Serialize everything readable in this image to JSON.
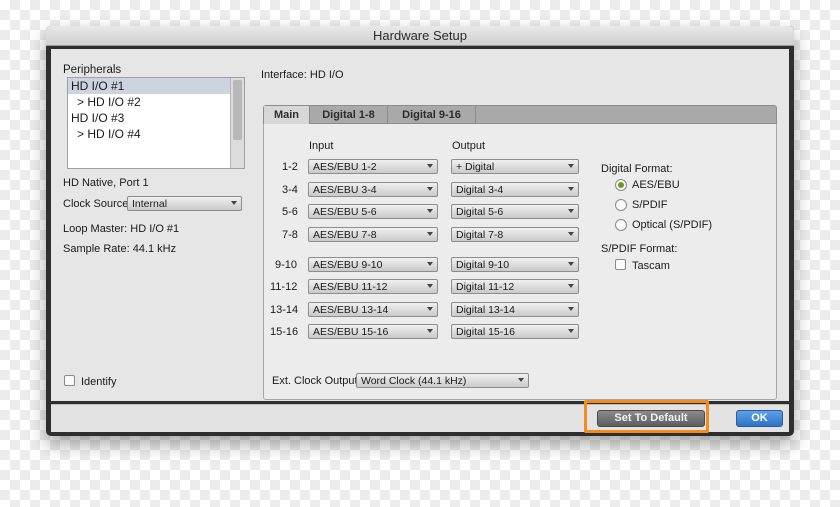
{
  "window": {
    "title": "Hardware Setup"
  },
  "peripherals": {
    "heading": "Peripherals",
    "items": [
      {
        "label": "HD I/O #1"
      },
      {
        "label": "> HD I/O #2"
      },
      {
        "label": "HD I/O #3"
      },
      {
        "label": "> HD I/O #4"
      }
    ]
  },
  "left": {
    "port": "HD Native, Port 1",
    "clock_source_label": "Clock Source:",
    "clock_source_value": "Internal",
    "loop_master": "Loop Master: HD I/O #1",
    "sample_rate": "Sample Rate:  44.1 kHz",
    "identify_label": "Identify"
  },
  "interface": {
    "label": "Interface: HD I/O"
  },
  "tabs": [
    {
      "label": "Main"
    },
    {
      "label": "Digital 1-8"
    },
    {
      "label": "Digital 9-16"
    }
  ],
  "io": {
    "input_header": "Input",
    "output_header": "Output",
    "rows": [
      {
        "channels": "1-2",
        "input": "AES/EBU 1-2",
        "output": "+ Digital"
      },
      {
        "channels": "3-4",
        "input": "AES/EBU 3-4",
        "output": "Digital 3-4"
      },
      {
        "channels": "5-6",
        "input": "AES/EBU 5-6",
        "output": "Digital 5-6"
      },
      {
        "channels": "7-8",
        "input": "AES/EBU 7-8",
        "output": "Digital 7-8"
      },
      {
        "channels": "9-10",
        "input": "AES/EBU 9-10",
        "output": "Digital 9-10"
      },
      {
        "channels": "11-12",
        "input": "AES/EBU 11-12",
        "output": "Digital 11-12"
      },
      {
        "channels": "13-14",
        "input": "AES/EBU 13-14",
        "output": "Digital 13-14"
      },
      {
        "channels": "15-16",
        "input": "AES/EBU 15-16",
        "output": "Digital 15-16"
      }
    ]
  },
  "digital_format": {
    "label": "Digital Format:",
    "options": [
      {
        "label": "AES/EBU",
        "selected": true
      },
      {
        "label": "S/PDIF",
        "selected": false
      },
      {
        "label": "Optical (S/PDIF)",
        "selected": false
      }
    ]
  },
  "spdif_format": {
    "label": "S/PDIF Format:",
    "tascam_label": "Tascam"
  },
  "ext_clock": {
    "label": "Ext. Clock Output:",
    "value": "Word Clock (44.1 kHz)"
  },
  "buttons": {
    "set_default": "Set To Default",
    "ok": "OK"
  },
  "colors": {
    "highlight": "#f28c1c",
    "ok_button": "#2d73c6",
    "radio_selected": "#6a9a1c"
  }
}
